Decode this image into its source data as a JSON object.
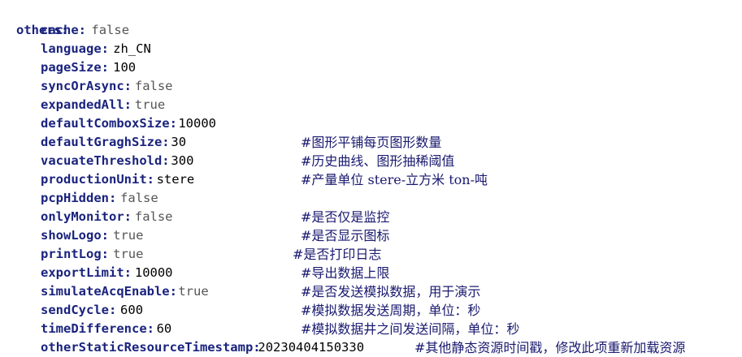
{
  "root_key": "others",
  "entries": [
    {
      "key": "cache",
      "value": "false",
      "type": "bool",
      "comment": ""
    },
    {
      "key": "language",
      "value": "zh_CN",
      "type": "str",
      "comment": ""
    },
    {
      "key": "pageSize",
      "value": "100",
      "type": "num",
      "comment": ""
    },
    {
      "key": "syncOrAsync",
      "value": "false",
      "type": "bool",
      "comment": ""
    },
    {
      "key": "expandedAll",
      "value": "true",
      "type": "bool",
      "comment": ""
    },
    {
      "key": "defaultComboxSize",
      "value": "10000",
      "type": "num",
      "comment": ""
    },
    {
      "key": "defaultGraghSize",
      "value": "30",
      "type": "num",
      "comment": "#图形平铺每页图形数量"
    },
    {
      "key": "vacuateThreshold",
      "value": "300",
      "type": "num",
      "comment": "#历史曲线、图形抽稀阈值"
    },
    {
      "key": "productionUnit",
      "value": "stere",
      "type": "str",
      "comment": "#产量单位 stere-立方米 ton-吨"
    },
    {
      "key": "pcpHidden",
      "value": "false",
      "type": "bool",
      "comment": ""
    },
    {
      "key": "onlyMonitor",
      "value": "false",
      "type": "bool",
      "comment": "#是否仅是监控"
    },
    {
      "key": "showLogo",
      "value": "true",
      "type": "bool",
      "comment": "#是否显示图标"
    },
    {
      "key": "printLog",
      "value": "true",
      "type": "bool",
      "comment": "#是否打印日志"
    },
    {
      "key": "exportLimit",
      "value": "10000",
      "type": "num",
      "comment": "#导出数据上限"
    },
    {
      "key": "simulateAcqEnable",
      "value": "true",
      "type": "bool",
      "comment": "#是否发送模拟数据，用于演示"
    },
    {
      "key": "sendCycle",
      "value": "600",
      "type": "num",
      "comment": "#模拟数据发送周期，单位：秒"
    },
    {
      "key": "timeDifference",
      "value": "60",
      "type": "num",
      "comment": "#模拟数据井之间发送间隔，单位：秒"
    },
    {
      "key": "otherStaticResourceTimestamp",
      "value": "20230404150330",
      "type": "num",
      "comment": "#其他静态资源时间戳，修改此项重新加载资源"
    }
  ]
}
